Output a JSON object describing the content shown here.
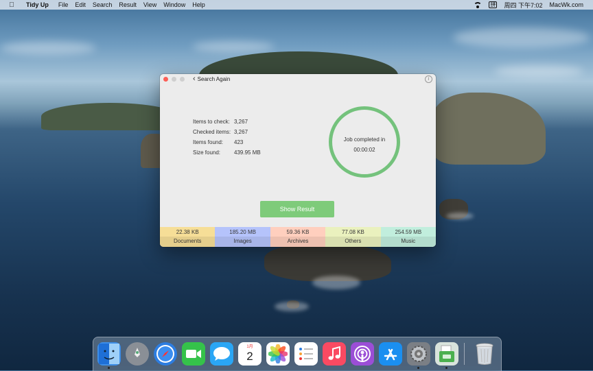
{
  "menubar": {
    "apple_icon": "apple-logo",
    "app_name": "Tidy Up",
    "menus": [
      "File",
      "Edit",
      "Search",
      "Result",
      "View",
      "Window",
      "Help"
    ],
    "right": {
      "wifi_icon": "wifi-icon",
      "input_source": "拼",
      "clock": "周四 下午7:02",
      "site": "MacWk.com"
    }
  },
  "window": {
    "back_label": "Search Again",
    "info_icon": "i",
    "stats": [
      {
        "label": "Items to check:",
        "value": "3,267"
      },
      {
        "label": "Checked items:",
        "value": "3,267"
      },
      {
        "label": "Items found:",
        "value": "423"
      },
      {
        "label": "Size found:",
        "value": "439.95 MB"
      }
    ],
    "status": {
      "line1": "Job completed in",
      "time": "00:00:02",
      "ring_color": "#74c27c"
    },
    "show_result_label": "Show Result",
    "categories": [
      {
        "size": "22.38 KB",
        "name": "Documents",
        "color": "#e4ce8c"
      },
      {
        "size": "185.20 MB",
        "name": "Images",
        "color": "#a8b5e8"
      },
      {
        "size": "59.36 KB",
        "name": "Archives",
        "color": "#edc0b0"
      },
      {
        "size": "77.08 KB",
        "name": "Others",
        "color": "#d9dfb0"
      },
      {
        "size": "254.59 MB",
        "name": "Music",
        "color": "#b3dccd"
      }
    ]
  },
  "dock": {
    "calendar_month": "1月",
    "calendar_day": "2",
    "apps": [
      {
        "name": "finder-icon",
        "bg": "#3d8ee8"
      },
      {
        "name": "launchpad-icon",
        "bg": "#8a8f96"
      },
      {
        "name": "safari-icon",
        "bg": "#2d7de0"
      },
      {
        "name": "facetime-icon",
        "bg": "#35c24a"
      },
      {
        "name": "messages-icon",
        "bg": "#2aa6f5"
      },
      {
        "name": "calendar-icon",
        "bg": "#ffffff"
      },
      {
        "name": "photos-icon",
        "bg": "#ffffff"
      },
      {
        "name": "reminders-icon",
        "bg": "#ffffff"
      },
      {
        "name": "music-icon",
        "bg": "#fa4a62"
      },
      {
        "name": "podcasts-icon",
        "bg": "#9b4ed6"
      },
      {
        "name": "app-store-icon",
        "bg": "#1b8ff0"
      },
      {
        "name": "system-preferences-icon",
        "bg": "#7b7f85"
      },
      {
        "name": "tidy-up-icon",
        "bg": "#d9e3dc"
      },
      {
        "name": "trash-icon",
        "bg": "transparent"
      }
    ]
  }
}
